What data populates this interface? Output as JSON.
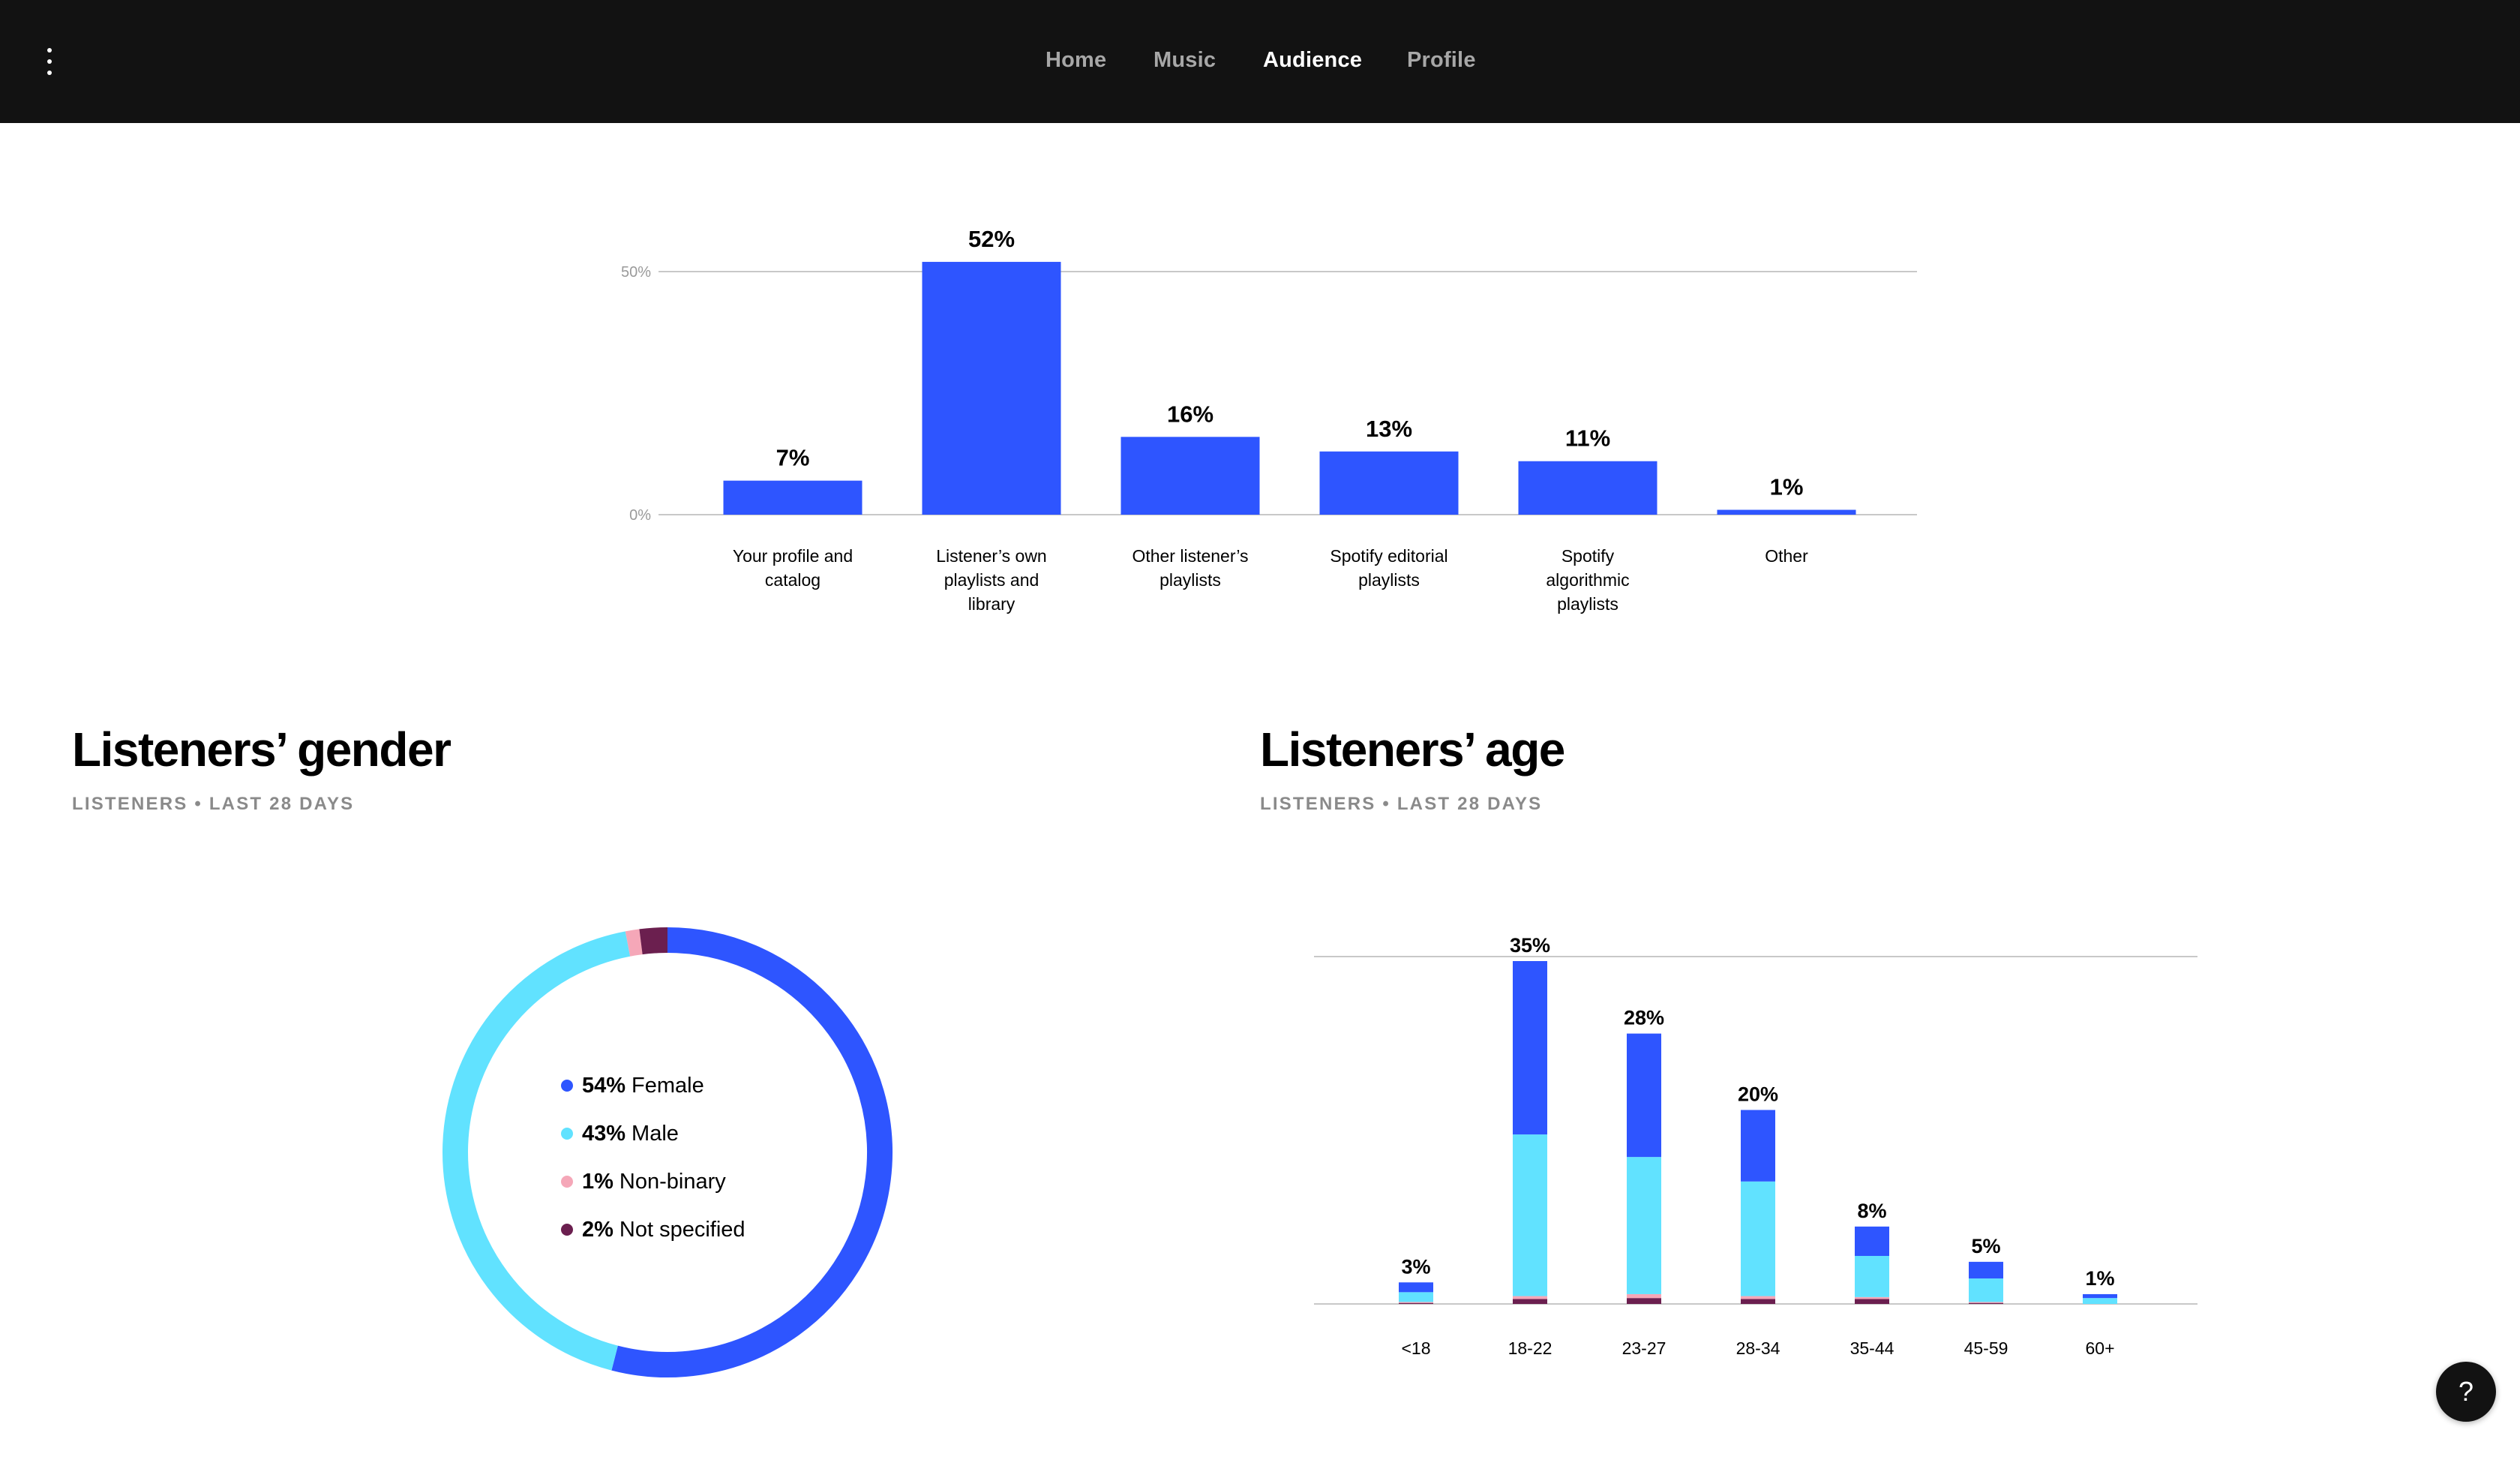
{
  "nav": {
    "items": [
      {
        "label": "Home",
        "active": false
      },
      {
        "label": "Music",
        "active": false
      },
      {
        "label": "Audience",
        "active": true
      },
      {
        "label": "Profile",
        "active": false
      }
    ]
  },
  "source_chart": {
    "gridlines": [
      "50%",
      "0%"
    ],
    "bars": [
      {
        "label_lines": [
          "Your profile and",
          "catalog"
        ],
        "value_label": "7%"
      },
      {
        "label_lines": [
          "Listener’s own",
          "playlists and",
          "library"
        ],
        "value_label": "52%"
      },
      {
        "label_lines": [
          "Other listener’s",
          "playlists"
        ],
        "value_label": "16%"
      },
      {
        "label_lines": [
          "Spotify editorial",
          "playlists"
        ],
        "value_label": "13%"
      },
      {
        "label_lines": [
          "Spotify",
          "algorithmic",
          "playlists"
        ],
        "value_label": "11%"
      },
      {
        "label_lines": [
          "Other"
        ],
        "value_label": "1%"
      }
    ]
  },
  "gender": {
    "title": "Listeners’ gender",
    "subtitle": "LISTENERS • LAST 28 DAYS",
    "legend": [
      {
        "pct": "54%",
        "label": "Female"
      },
      {
        "pct": "43%",
        "label": "Male"
      },
      {
        "pct": "1%",
        "label": "Non-binary"
      },
      {
        "pct": "2%",
        "label": "Not specified"
      }
    ]
  },
  "age": {
    "title": "Listeners’ age",
    "subtitle": "LISTENERS • LAST 28 DAYS"
  },
  "help": {
    "label": "?"
  },
  "colors": {
    "accent": "#2e55ff",
    "female": "#2e55ff",
    "male": "#61e2ff",
    "nonbinary": "#f5a7b8",
    "not_specified": "#6b1f4f",
    "topbar": "#121212"
  },
  "chart_data": [
    {
      "type": "bar",
      "categories": [
        "Your profile and catalog",
        "Listener’s own playlists and library",
        "Other listener’s playlists",
        "Spotify editorial playlists",
        "Spotify algorithmic playlists",
        "Other"
      ],
      "values": [
        7,
        52,
        16,
        13,
        11,
        1
      ],
      "ylim": [
        0,
        50
      ],
      "yticks": [
        "0%",
        "50%"
      ],
      "grid": true
    },
    {
      "type": "pie",
      "labels": [
        "Female",
        "Male",
        "Non-binary",
        "Not specified"
      ],
      "values": [
        54,
        43,
        1,
        2
      ],
      "donut": true
    },
    {
      "type": "bar",
      "stacked": true,
      "categories": [
        "<18",
        "18-22",
        "23-27",
        "28-34",
        "35-44",
        "45-59",
        "60+"
      ],
      "totals": [
        3,
        35,
        28,
        20,
        8,
        5,
        1
      ],
      "total_labels": [
        "3%",
        "35%",
        "28%",
        "20%",
        "8%",
        "5%",
        "1%"
      ],
      "series": [
        {
          "name": "Female",
          "values": [
            1.0,
            17.7,
            12.6,
            7.3,
            3.0,
            1.7,
            0.4
          ]
        },
        {
          "name": "Male",
          "values": [
            1.0,
            16.5,
            14.0,
            11.7,
            4.2,
            2.4,
            0.6
          ]
        },
        {
          "name": "Non-binary",
          "values": [
            0.1,
            0.3,
            0.4,
            0.3,
            0.2,
            0.1,
            0.0
          ]
        },
        {
          "name": "Not specified",
          "values": [
            0.1,
            0.5,
            0.6,
            0.5,
            0.5,
            0.1,
            0.0
          ]
        }
      ],
      "grid": true
    }
  ]
}
